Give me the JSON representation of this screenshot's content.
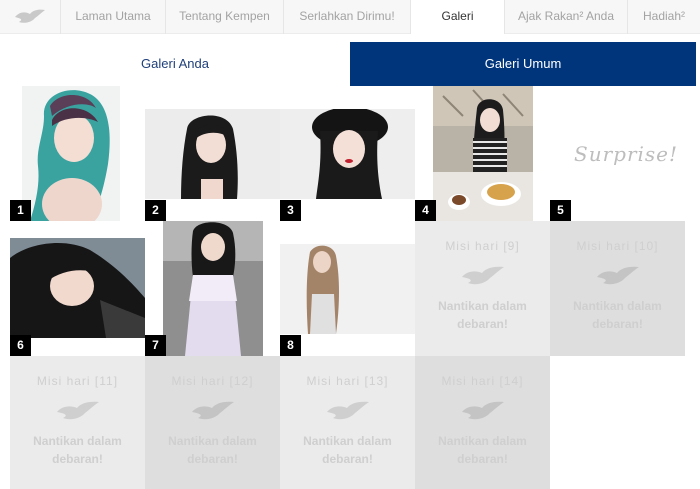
{
  "brand": {
    "logo_icon": "dove-icon",
    "accent": "#00357c",
    "tab_text": "#1f3f7a"
  },
  "nav": {
    "items": [
      {
        "label": "Laman Utama"
      },
      {
        "label": "Tentang Kempen"
      },
      {
        "label": "Serlahkan Dirimu!"
      },
      {
        "label": "Galeri"
      },
      {
        "label": "Ajak Rakan² Anda"
      },
      {
        "label": "Hadiah²"
      }
    ],
    "active": "Galeri"
  },
  "tabs": {
    "own": "Galeri Anda",
    "public": "Galeri Umum",
    "active": "Galeri Umum"
  },
  "gallery": {
    "tiles": [
      {
        "number": "1"
      },
      {
        "number": "2"
      },
      {
        "number": "3"
      },
      {
        "number": "4"
      },
      {
        "number": "5",
        "text": "Surprise!"
      },
      {
        "number": "6"
      },
      {
        "number": "7"
      },
      {
        "number": "8"
      }
    ],
    "locked": [
      {
        "title": "Misi hari [9]",
        "message": "Nantikan dalam debaran!"
      },
      {
        "title": "Misi hari [10]",
        "message": "Nantikan dalam debaran!"
      },
      {
        "title": "Misi hari [11]",
        "message": "Nantikan dalam debaran!"
      },
      {
        "title": "Misi hari [12]",
        "message": "Nantikan dalam debaran!"
      },
      {
        "title": "Misi hari [13]",
        "message": "Nantikan dalam debaran!"
      },
      {
        "title": "Misi hari [14]",
        "message": "Nantikan dalam debaran!"
      }
    ]
  }
}
